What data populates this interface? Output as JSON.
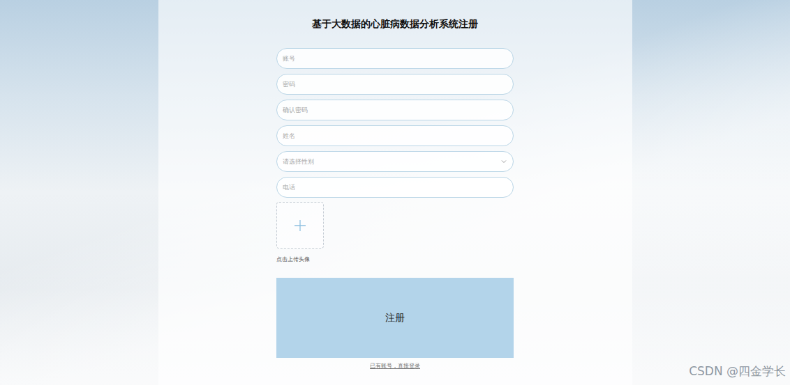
{
  "title": "基于大数据的心脏病数据分析系统注册",
  "fields": [
    {
      "placeholder": "账号",
      "kind": "input"
    },
    {
      "placeholder": "密码",
      "kind": "input"
    },
    {
      "placeholder": "确认密码",
      "kind": "input"
    },
    {
      "placeholder": "姓名",
      "kind": "input"
    },
    {
      "placeholder": "请选择性别",
      "kind": "select"
    },
    {
      "placeholder": "电话",
      "kind": "input"
    }
  ],
  "upload": {
    "label": "点击上传头像"
  },
  "submit": "注册",
  "login_link": "已有账号，直接登录",
  "watermark": "CSDN @四金学长"
}
